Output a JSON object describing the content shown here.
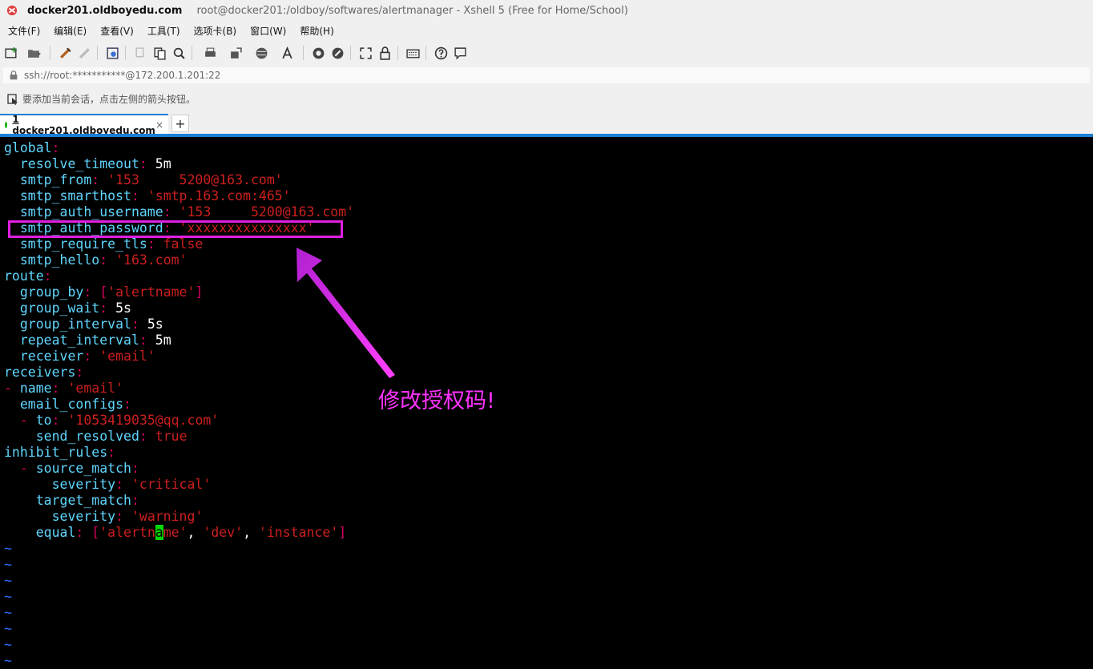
{
  "window": {
    "host": "docker201.oldboyedu.com",
    "title": "root@docker201:/oldboy/softwares/alertmanager - Xshell 5 (Free for Home/School)"
  },
  "menu": [
    "文件(F)",
    "编辑(E)",
    "查看(V)",
    "工具(T)",
    "选项卡(B)",
    "窗口(W)",
    "帮助(H)"
  ],
  "address": "ssh://root:***********@172.200.1.201:22",
  "hint": "要添加当前会话，点击左侧的箭头按钮。",
  "tab": {
    "label": "1 docker201.oldboyedu.com",
    "close": "×",
    "new": "+"
  },
  "terminal": {
    "lines": [
      [
        {
          "t": "global",
          "c": "k"
        },
        {
          "t": ":",
          "c": "p"
        }
      ],
      [
        {
          "t": "  resolve_timeout",
          "c": "k"
        },
        {
          "t": ":",
          "c": "p"
        },
        {
          "t": " 5m",
          "c": "v"
        }
      ],
      [
        {
          "t": "  smtp_from",
          "c": "k"
        },
        {
          "t": ":",
          "c": "p"
        },
        {
          "t": " '153     5200@163.com'",
          "c": "s"
        }
      ],
      [
        {
          "t": "  smtp_smarthost",
          "c": "k"
        },
        {
          "t": ":",
          "c": "p"
        },
        {
          "t": " 'smtp.163.com:465'",
          "c": "s"
        }
      ],
      [
        {
          "t": "  smtp_auth_username",
          "c": "k"
        },
        {
          "t": ":",
          "c": "p"
        },
        {
          "t": " '153     5200@163.com'",
          "c": "s"
        }
      ],
      [
        {
          "t": "  smtp_auth_password",
          "c": "k"
        },
        {
          "t": ":",
          "c": "p"
        },
        {
          "t": " 'xxxxxxxxxxxxxxx'",
          "c": "s"
        }
      ],
      [
        {
          "t": "  smtp_require_tls",
          "c": "k"
        },
        {
          "t": ":",
          "c": "p"
        },
        {
          "t": " false",
          "c": "s"
        }
      ],
      [
        {
          "t": "  smtp_hello",
          "c": "k"
        },
        {
          "t": ":",
          "c": "p"
        },
        {
          "t": " '163.com'",
          "c": "s"
        }
      ],
      [
        {
          "t": "route",
          "c": "k"
        },
        {
          "t": ":",
          "c": "p"
        }
      ],
      [
        {
          "t": "  group_by",
          "c": "k"
        },
        {
          "t": ":",
          "c": "p"
        },
        {
          "t": " [",
          "c": "p"
        },
        {
          "t": "'alertname'",
          "c": "s"
        },
        {
          "t": "]",
          "c": "p"
        }
      ],
      [
        {
          "t": "  group_wait",
          "c": "k"
        },
        {
          "t": ":",
          "c": "p"
        },
        {
          "t": " 5s",
          "c": "v"
        }
      ],
      [
        {
          "t": "  group_interval",
          "c": "k"
        },
        {
          "t": ":",
          "c": "p"
        },
        {
          "t": " 5s",
          "c": "v"
        }
      ],
      [
        {
          "t": "  repeat_interval",
          "c": "k"
        },
        {
          "t": ":",
          "c": "p"
        },
        {
          "t": " 5m",
          "c": "v"
        }
      ],
      [
        {
          "t": "  receiver",
          "c": "k"
        },
        {
          "t": ":",
          "c": "p"
        },
        {
          "t": " 'email'",
          "c": "s"
        }
      ],
      [
        {
          "t": "receivers",
          "c": "k"
        },
        {
          "t": ":",
          "c": "p"
        }
      ],
      [
        {
          "t": "- ",
          "c": "p"
        },
        {
          "t": "name",
          "c": "k"
        },
        {
          "t": ":",
          "c": "p"
        },
        {
          "t": " 'email'",
          "c": "s"
        }
      ],
      [
        {
          "t": "  email_configs",
          "c": "k"
        },
        {
          "t": ":",
          "c": "p"
        }
      ],
      [
        {
          "t": "  - ",
          "c": "p"
        },
        {
          "t": "to",
          "c": "k"
        },
        {
          "t": ":",
          "c": "p"
        },
        {
          "t": " '1053419035@qq.com'",
          "c": "s"
        }
      ],
      [
        {
          "t": "    send_resolved",
          "c": "k"
        },
        {
          "t": ":",
          "c": "p"
        },
        {
          "t": " true",
          "c": "s"
        }
      ],
      [
        {
          "t": "inhibit_rules",
          "c": "k"
        },
        {
          "t": ":",
          "c": "p"
        }
      ],
      [
        {
          "t": "  - ",
          "c": "p"
        },
        {
          "t": "source_match",
          "c": "k"
        },
        {
          "t": ":",
          "c": "p"
        }
      ],
      [
        {
          "t": "      severity",
          "c": "k"
        },
        {
          "t": ":",
          "c": "p"
        },
        {
          "t": " 'critical'",
          "c": "s"
        }
      ],
      [
        {
          "t": "    target_match",
          "c": "k"
        },
        {
          "t": ":",
          "c": "p"
        }
      ],
      [
        {
          "t": "      severity",
          "c": "k"
        },
        {
          "t": ":",
          "c": "p"
        },
        {
          "t": " 'warning'",
          "c": "s"
        }
      ],
      [
        {
          "t": "    equal",
          "c": "k"
        },
        {
          "t": ":",
          "c": "p"
        },
        {
          "t": " [",
          "c": "p"
        },
        {
          "t": "'alertn",
          "c": "s"
        },
        {
          "t": "a",
          "c": "cur"
        },
        {
          "t": "me'",
          "c": "s"
        },
        {
          "t": ",",
          "c": "v"
        },
        {
          "t": " 'dev'",
          "c": "s"
        },
        {
          "t": ",",
          "c": "v"
        },
        {
          "t": " 'instance'",
          "c": "s"
        },
        {
          "t": "]",
          "c": "p"
        }
      ],
      [
        {
          "t": "~",
          "c": "t"
        }
      ],
      [
        {
          "t": "~",
          "c": "t"
        }
      ],
      [
        {
          "t": "~",
          "c": "t"
        }
      ],
      [
        {
          "t": "~",
          "c": "t"
        }
      ],
      [
        {
          "t": "~",
          "c": "t"
        }
      ],
      [
        {
          "t": "~",
          "c": "t"
        }
      ],
      [
        {
          "t": "~",
          "c": "t"
        }
      ],
      [
        {
          "t": "~",
          "c": "t"
        }
      ]
    ]
  },
  "annotation": "修改授权码!",
  "colors": {
    "accent": "#1a7fd4",
    "annotation": "#ff33ff",
    "key": "#5fd7ff",
    "string": "#cc1f1f",
    "punct": "#d7005f"
  }
}
